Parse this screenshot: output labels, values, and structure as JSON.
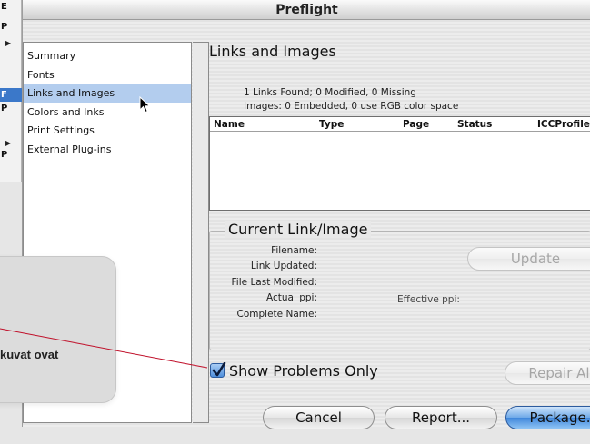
{
  "background_menu": {
    "rows": [
      {
        "text": "E",
        "selected": false
      },
      {
        "text": "P",
        "selected": false
      },
      {
        "text": "",
        "selected": false,
        "arrow": true
      },
      {
        "text": "F",
        "selected": true
      },
      {
        "text": "P",
        "selected": false
      },
      {
        "text": "",
        "selected": false,
        "arrow": true
      },
      {
        "text": "P",
        "selected": false
      }
    ]
  },
  "window": {
    "title": "Preflight"
  },
  "sections": {
    "items": [
      {
        "label": "Summary",
        "selected": false
      },
      {
        "label": "Fonts",
        "selected": false
      },
      {
        "label": "Links and Images",
        "selected": true
      },
      {
        "label": "Colors and Inks",
        "selected": false
      },
      {
        "label": "Print Settings",
        "selected": false
      },
      {
        "label": "External Plug-ins",
        "selected": false
      }
    ]
  },
  "panel": {
    "title": "Links and Images",
    "summary_1": "1 Links Found; 0 Modified, 0 Missing",
    "summary_2": "Images: 0 Embedded, 0 use RGB color space",
    "columns": [
      "Name",
      "Type",
      "Page",
      "Status",
      "ICCProfile"
    ]
  },
  "current_link": {
    "title": "Current Link/Image",
    "fields": [
      "Filename:",
      "Link Updated:",
      "File Last Modified:",
      "Actual ppi:",
      "Complete Name:"
    ],
    "effective_ppi_label": "Effective ppi:",
    "update_label": "Update"
  },
  "show_problems": {
    "label": "Show Problems Only",
    "checked": true
  },
  "buttons": {
    "repair_label": "Repair Al",
    "cancel_label": "Cancel",
    "report_label": "Report...",
    "package_label": "Package."
  },
  "callout": {
    "text": "kuvat ovat"
  },
  "colors": {
    "selection": "#b3cdee",
    "menu_selection": "#3b78c9",
    "pointer_line": "#c0102a",
    "default_button": "#3f86db"
  }
}
